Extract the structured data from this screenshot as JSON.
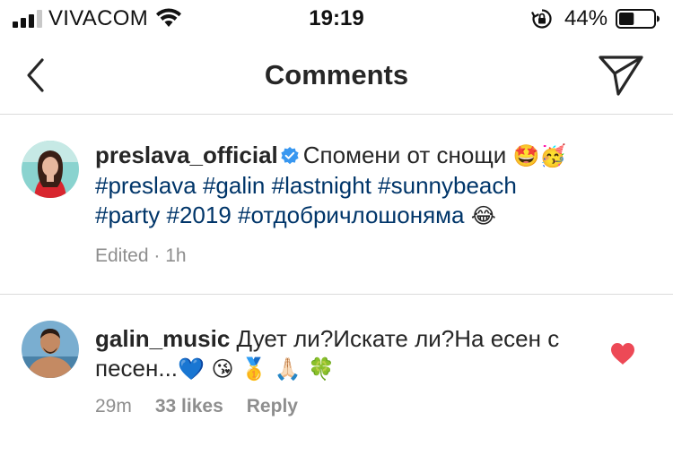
{
  "status_bar": {
    "carrier": "VIVACOM",
    "time": "19:19",
    "battery_percent": "44%",
    "battery_level": 0.44,
    "icons": [
      "signal-bars-icon",
      "wifi-icon",
      "orientation-lock-icon",
      "battery-icon"
    ]
  },
  "nav": {
    "title": "Comments",
    "icons": [
      "chevron-left-icon",
      "send-direct-icon"
    ]
  },
  "caption": {
    "username": "preslava_official",
    "verified": true,
    "text": "Спомени от снощи",
    "emoji_1": "🤩",
    "emoji_2": "🥳",
    "hashtags": [
      "#preslava",
      "#galin",
      "#lastnight",
      "#sunnybeach",
      "#party",
      "#2019",
      "#отдобричлошоняма"
    ],
    "trailing_emoji": "😂",
    "meta": "Edited · 1h"
  },
  "comment": {
    "username": "galin_music",
    "text": "Дует ли?Искате ли?На есен с песен...",
    "emojis": "💙 😘 🥇 🙏🏻 🍀",
    "time": "29m",
    "likes": "33 likes",
    "reply": "Reply",
    "liked": true
  },
  "colors": {
    "hashtag": "#003569",
    "meta": "#8e8e8e",
    "heart": "#ed4956",
    "verified": "#3897f0",
    "divider": "#dbdbdb"
  }
}
